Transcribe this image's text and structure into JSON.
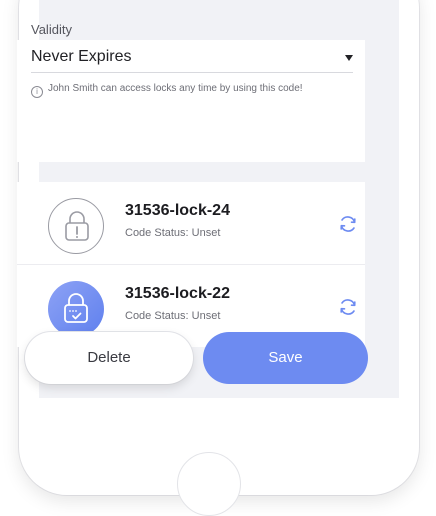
{
  "validity": {
    "label": "Validity",
    "value": "Never Expires",
    "hint": "John Smith can access locks any time by using this code!"
  },
  "locks": [
    {
      "name": "31536-lock-24",
      "status": "Code Status: Unset",
      "icon": "padlock-warning-icon"
    },
    {
      "name": "31536-lock-22",
      "status": "Code Status: Unset",
      "icon": "padlock-check-icon"
    }
  ],
  "actions": {
    "delete_label": "Delete",
    "save_label": "Save"
  },
  "colors": {
    "accent": "#6d8bf1",
    "background": "#f1f2f6"
  }
}
